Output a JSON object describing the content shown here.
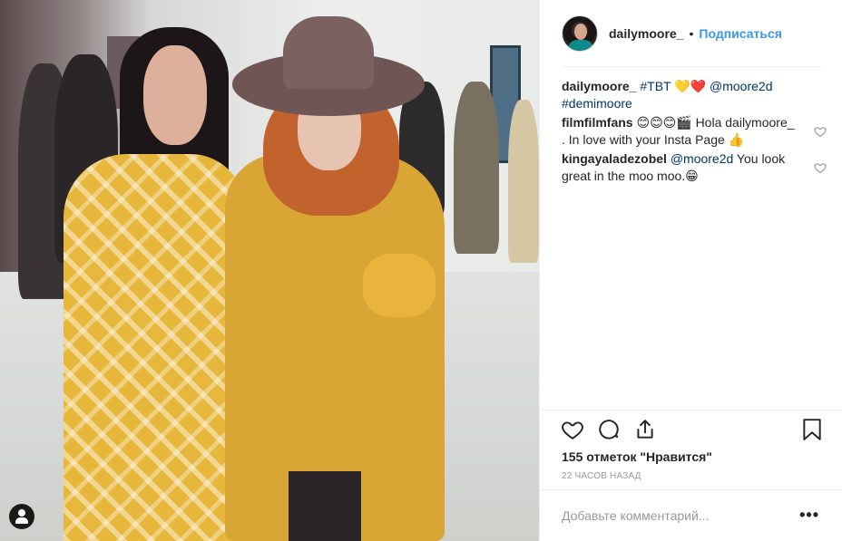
{
  "post": {
    "photo_alt": "",
    "header": {
      "username": "dailymoore_",
      "dot": "•",
      "follow_label": "Подписаться"
    },
    "caption": {
      "author": "dailymoore_",
      "text_before": " ",
      "hashtag1": "#TBT",
      "emoji": " 💛❤️ ",
      "mention": "@moore2d",
      "hashtag2": "#demimoore"
    },
    "comments": [
      {
        "author": "filmfilmfans",
        "text": " 😊😊😊🎬 Hola dailymoore_ . In love with your Insta Page 👍",
        "like_icon": "heart-outline-icon"
      },
      {
        "author": "kingayaladezobel",
        "mention": "@moore2d",
        "text": " You look great in the moo moo.😁",
        "like_icon": "heart-outline-icon"
      }
    ],
    "actions": {
      "like_icon": "heart-outline-icon",
      "comment_icon": "comment-bubble-icon",
      "share_icon": "share-upload-icon",
      "save_icon": "bookmark-icon"
    },
    "likes_text": "155 отметок \"Нравится\"",
    "time_text": "22 часов назад",
    "comment_placeholder": "Добавьте комментарий...",
    "more_label": "•••",
    "tag_badge_icon": "user-tag-icon"
  }
}
